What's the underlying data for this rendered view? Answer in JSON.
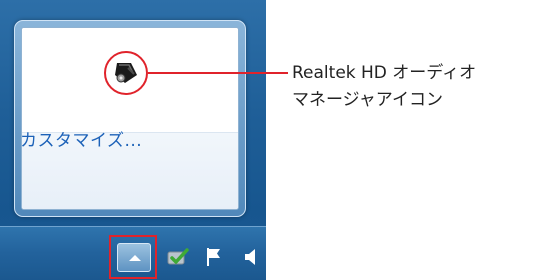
{
  "popup": {
    "customize_label": "カスタマイズ..."
  },
  "tray_icons": [
    {
      "name": "realtek-hd-audio-manager",
      "icon": "speaker-note-icon"
    },
    {
      "name": "action-center",
      "icon": "checkmark-icon"
    },
    {
      "name": "action-flag",
      "icon": "flag-icon"
    },
    {
      "name": "volume",
      "icon": "speaker-icon"
    }
  ],
  "callout": {
    "line1": "Realtek HD オーディオ",
    "line2": "マネージャアイコン"
  },
  "taskbar": {
    "show_hidden_icons": "show-hidden-icons-arrow"
  },
  "colors": {
    "highlight": "#e0232b",
    "link": "#1d62b8",
    "taskbar": "#1f5f98"
  }
}
